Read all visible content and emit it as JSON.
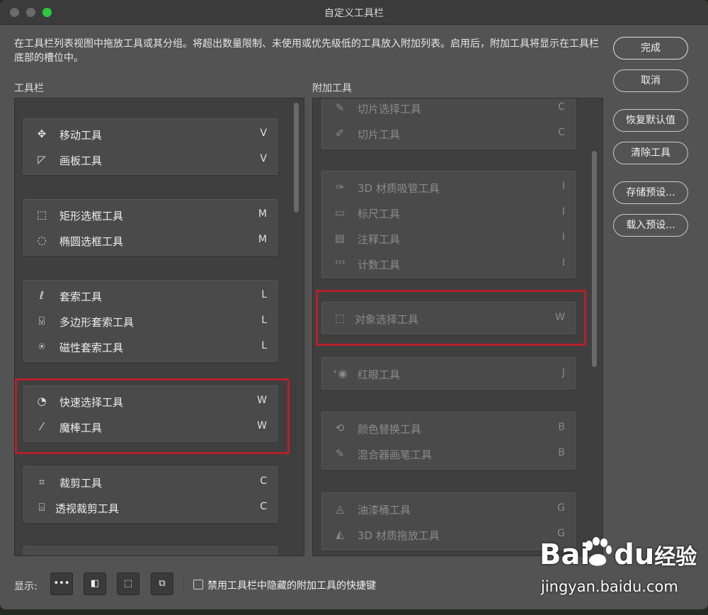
{
  "window": {
    "title": "自定义工具栏"
  },
  "description": "在工具栏列表视图中拖放工具或其分组。将超出数量限制、未使用或优先级低的工具放入附加列表。启用后，附加工具将显示在工具栏底部的槽位中。",
  "toolbar_label": "工具栏",
  "extra_label": "附加工具",
  "toolbar_groups": [
    {
      "tools": [
        {
          "icon": "move-icon",
          "glyph": "✥",
          "label": "移动工具",
          "key": "V"
        },
        {
          "icon": "artboard-icon",
          "glyph": "◸",
          "label": "画板工具",
          "key": "V"
        }
      ]
    },
    {
      "tools": [
        {
          "icon": "rect-marquee-icon",
          "glyph": "⬚",
          "label": "矩形选框工具",
          "key": "M"
        },
        {
          "icon": "ellipse-marquee-icon",
          "glyph": "◌",
          "label": "椭圆选框工具",
          "key": "M"
        }
      ]
    },
    {
      "tools": [
        {
          "icon": "lasso-icon",
          "glyph": "ℓ",
          "label": "套索工具",
          "key": "L"
        },
        {
          "icon": "polygon-lasso-icon",
          "glyph": "⍌",
          "label": "多边形套索工具",
          "key": "L"
        },
        {
          "icon": "magnetic-lasso-icon",
          "glyph": "⍟",
          "label": "磁性套索工具",
          "key": "L"
        }
      ]
    },
    {
      "tools": [
        {
          "icon": "quick-select-icon",
          "glyph": "◔",
          "label": "快速选择工具",
          "key": "W"
        },
        {
          "icon": "magic-wand-icon",
          "glyph": "⁄",
          "label": "魔棒工具",
          "key": "W"
        }
      ]
    },
    {
      "tools": [
        {
          "icon": "crop-icon",
          "glyph": "⌗",
          "label": "裁剪工具",
          "key": "C"
        },
        {
          "icon": "perspective-crop-icon",
          "glyph": "⌸",
          "label": "透视裁剪工具",
          "key": "C"
        }
      ]
    }
  ],
  "extra_groups": [
    {
      "tools": [
        {
          "icon": "slice-select-icon",
          "glyph": "✎",
          "label": "切片选择工具",
          "key": "C"
        },
        {
          "icon": "slice-icon",
          "glyph": "✐",
          "label": "切片工具",
          "key": "C"
        }
      ]
    },
    {
      "tools": [
        {
          "icon": "material-eyedropper-icon",
          "glyph": "✑",
          "label": "3D 材质吸管工具",
          "key": "I"
        },
        {
          "icon": "ruler-icon",
          "glyph": "▭",
          "label": "标尺工具",
          "key": "I"
        },
        {
          "icon": "note-icon",
          "glyph": "▤",
          "label": "注释工具",
          "key": "I"
        },
        {
          "icon": "count-icon",
          "glyph": "¹²³",
          "label": "计数工具",
          "key": "I"
        }
      ]
    },
    {
      "tools": [
        {
          "icon": "object-select-icon",
          "glyph": "⬚",
          "label": "对象选择工具",
          "key": "W"
        }
      ]
    },
    {
      "tools": [
        {
          "icon": "red-eye-icon",
          "glyph": "⁺◉",
          "label": "红眼工具",
          "key": "J"
        }
      ]
    },
    {
      "tools": [
        {
          "icon": "color-replace-icon",
          "glyph": "⟲",
          "label": "颜色替换工具",
          "key": "B"
        },
        {
          "icon": "mixer-brush-icon",
          "glyph": "✎",
          "label": "混合器画笔工具",
          "key": "B"
        }
      ]
    },
    {
      "tools": [
        {
          "icon": "paint-bucket-icon",
          "glyph": "◬",
          "label": "油漆桶工具",
          "key": "G"
        },
        {
          "icon": "material-drop-icon",
          "glyph": "◭",
          "label": "3D 材质拖放工具",
          "key": "G"
        }
      ]
    }
  ],
  "buttons": {
    "done": "完成",
    "cancel": "取消",
    "restore": "恢复默认值",
    "clear": "清除工具",
    "save_preset": "存储预设...",
    "load_preset": "载入预设..."
  },
  "footer": {
    "show_label": "显示:",
    "disable_label": "禁用工具栏中隐藏的附加工具的快捷键",
    "b1": "•••",
    "b2": "◧",
    "b3": "⬚",
    "b4": "⧉"
  },
  "watermark": {
    "logo_a": "Bai",
    "logo_b": "du",
    "logo_c": "经验",
    "sub": "jingyan.baidu.com"
  }
}
